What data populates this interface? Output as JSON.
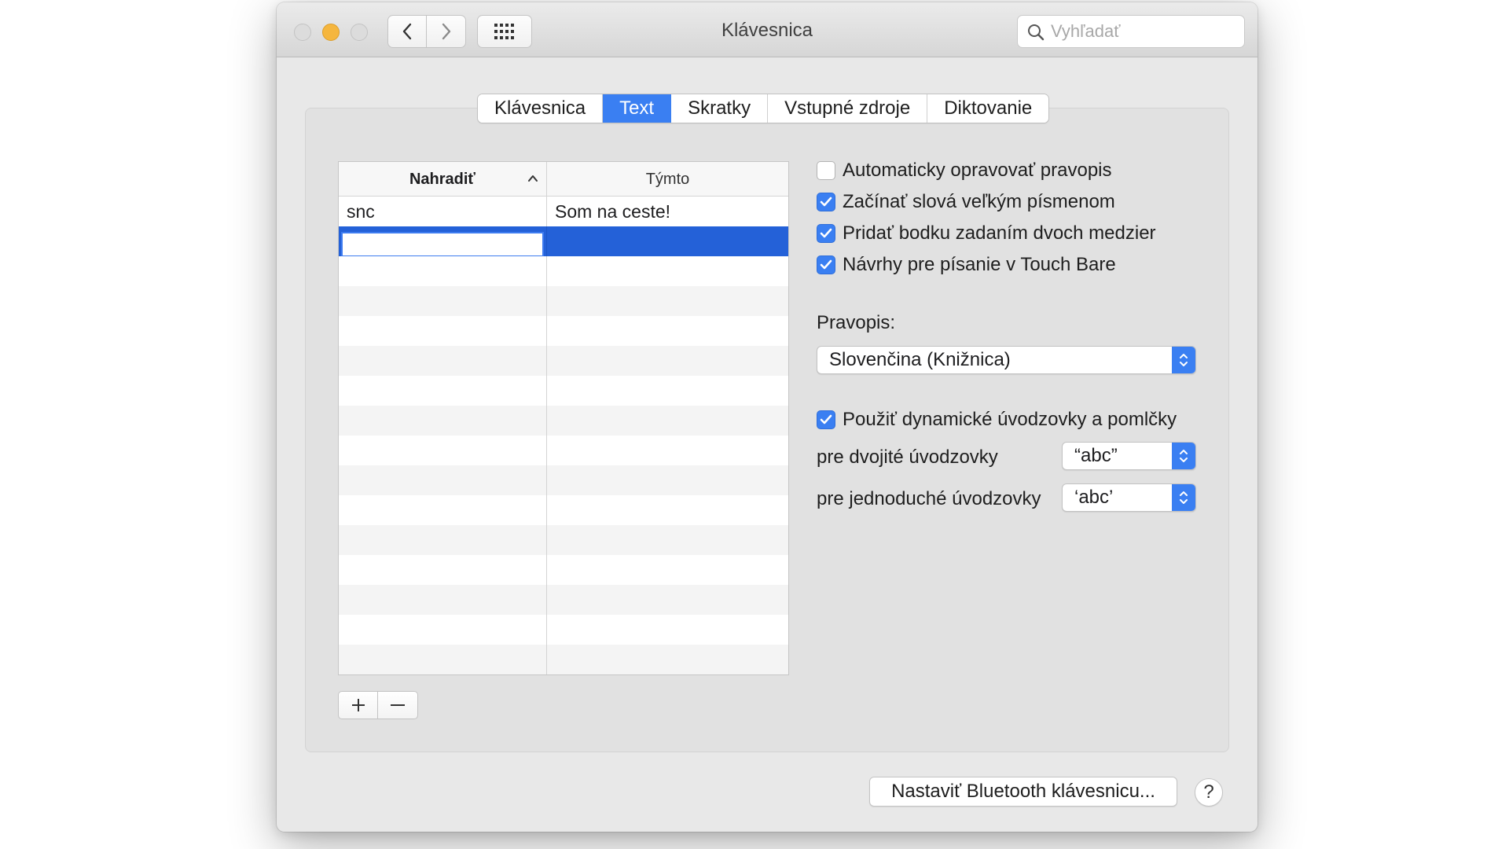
{
  "window": {
    "title": "Klávesnica"
  },
  "search": {
    "placeholder": "Vyhľadať"
  },
  "tabs": [
    {
      "label": "Klávesnica",
      "active": false
    },
    {
      "label": "Text",
      "active": true
    },
    {
      "label": "Skratky",
      "active": false
    },
    {
      "label": "Vstupné zdroje",
      "active": false
    },
    {
      "label": "Diktovanie",
      "active": false
    }
  ],
  "table": {
    "columns": [
      "Nahradiť",
      "Týmto"
    ],
    "rows": [
      {
        "replace": "snc",
        "with": "Som na ceste!"
      },
      {
        "replace": "",
        "with": ""
      }
    ]
  },
  "options": {
    "auto_correct": {
      "label": "Automaticky opravovať pravopis",
      "checked": false
    },
    "capitalize": {
      "label": "Začínať slová veľkým písmenom",
      "checked": true
    },
    "double_space_period": {
      "label": "Pridať bodku zadaním dvoch medzier",
      "checked": true
    },
    "touch_bar": {
      "label": "Návrhy pre písanie v Touch Bare",
      "checked": true
    }
  },
  "spelling": {
    "label": "Pravopis:",
    "value": "Slovenčina (Knižnica)"
  },
  "smart_quotes": {
    "label": "Použiť dynamické úvodzovky a pomlčky",
    "checked": true,
    "double_label": "pre dvojité úvodzovky",
    "double_value": "“abc”",
    "single_label": "pre jednoduché úvodzovky",
    "single_value": "‘abc’"
  },
  "footer": {
    "bluetooth_button": "Nastaviť Bluetooth klávesnicu...",
    "help_button": "?"
  },
  "colors": {
    "accent": "#3a7ff2",
    "selection": "#2461d8",
    "window_bg": "#e8e8e8"
  }
}
